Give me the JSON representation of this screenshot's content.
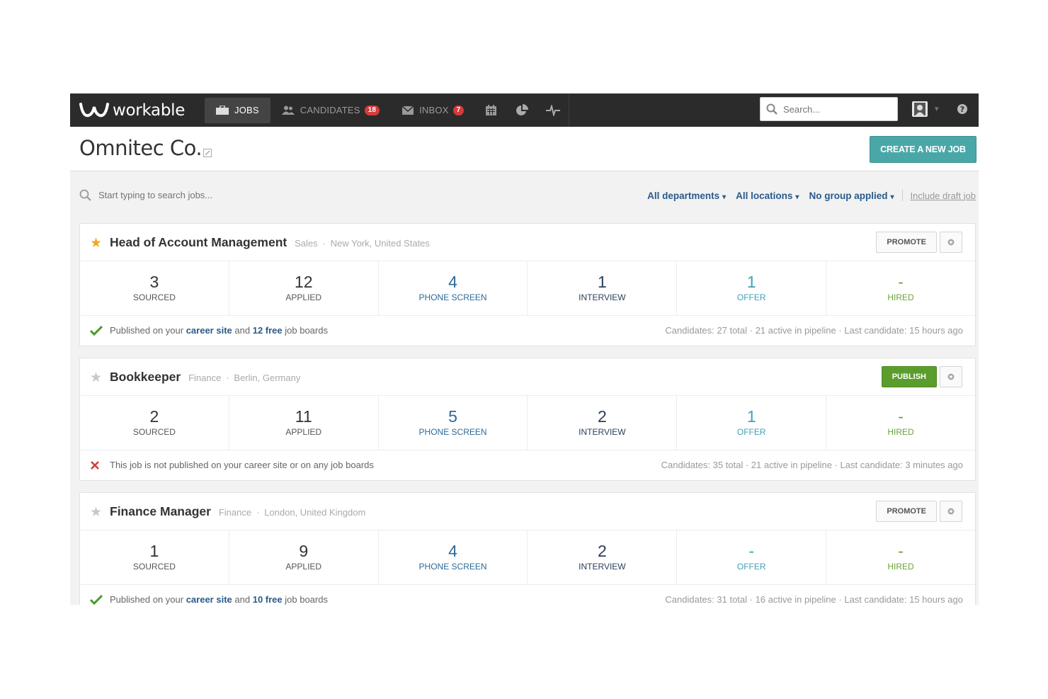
{
  "brand": {
    "name": "workable"
  },
  "nav": {
    "jobs": "JOBS",
    "candidates": "CANDIDATES",
    "candidates_badge": "18",
    "inbox": "INBOX",
    "inbox_badge": "7"
  },
  "search": {
    "placeholder": "Search..."
  },
  "page": {
    "company": "Omnitec Co.",
    "create_button": "CREATE A NEW JOB"
  },
  "filters": {
    "job_search_placeholder": "Start typing to search jobs...",
    "departments": "All departments",
    "locations": "All locations",
    "group": "No group applied",
    "draft": "Include draft job"
  },
  "jobs": [
    {
      "title": "Head of Account Management",
      "department": "Sales",
      "location": "New York, United States",
      "starred": true,
      "action": "PROMOTE",
      "stats": {
        "sourced": "3",
        "sourced_label": "SOURCED",
        "applied": "12",
        "applied_label": "APPLIED",
        "phone": "4",
        "phone_label": "PHONE SCREEN",
        "interview": "1",
        "interview_label": "INTERVIEW",
        "offer": "1",
        "offer_label": "OFFER",
        "hired": "-",
        "hired_label": "HIRED"
      },
      "published": true,
      "pub_prefix": "Published on your",
      "pub_site": "career site",
      "pub_and": "and",
      "pub_boards": "12 free",
      "pub_suffix": "job boards",
      "summary": "Candidates: 27 total · 21 active in pipeline · Last candidate: 15 hours ago"
    },
    {
      "title": "Bookkeeper",
      "department": "Finance",
      "location": "Berlin, Germany",
      "starred": false,
      "action": "PUBLISH",
      "stats": {
        "sourced": "2",
        "sourced_label": "SOURCED",
        "applied": "11",
        "applied_label": "APPLIED",
        "phone": "5",
        "phone_label": "PHONE SCREEN",
        "interview": "2",
        "interview_label": "INTERVIEW",
        "offer": "1",
        "offer_label": "OFFER",
        "hired": "-",
        "hired_label": "HIRED"
      },
      "published": false,
      "unpublished_text": "This job is not published on your career site or on any job boards",
      "summary": "Candidates: 35 total · 21 active in pipeline · Last candidate: 3 minutes ago"
    },
    {
      "title": "Finance Manager",
      "department": "Finance",
      "location": "London, United Kingdom",
      "starred": false,
      "action": "PROMOTE",
      "stats": {
        "sourced": "1",
        "sourced_label": "SOURCED",
        "applied": "9",
        "applied_label": "APPLIED",
        "phone": "4",
        "phone_label": "PHONE SCREEN",
        "interview": "2",
        "interview_label": "INTERVIEW",
        "offer": "-",
        "offer_label": "OFFER",
        "hired": "-",
        "hired_label": "HIRED"
      },
      "published": true,
      "pub_prefix": "Published on your",
      "pub_site": "career site",
      "pub_and": "and",
      "pub_boards": "10 free",
      "pub_suffix": "job boards",
      "summary": "Candidates: 31 total · 16 active in pipeline · Last candidate: 15 hours ago"
    }
  ],
  "colors": {
    "topbar": "#2b2b2b",
    "create_button": "#4aa7a8",
    "publish_button": "#5b9d2c",
    "star_active": "#f5a623",
    "badge": "#d63b3b",
    "link": "#2a5a8a"
  },
  "icons": [
    "workable-logo-icon",
    "briefcase-icon",
    "people-icon",
    "envelope-icon",
    "calendar-icon",
    "pie-chart-icon",
    "activity-icon",
    "search-icon",
    "avatar-icon",
    "help-icon",
    "edit-icon",
    "star-icon",
    "gear-icon",
    "check-icon",
    "cross-icon",
    "chevron-down-icon"
  ]
}
